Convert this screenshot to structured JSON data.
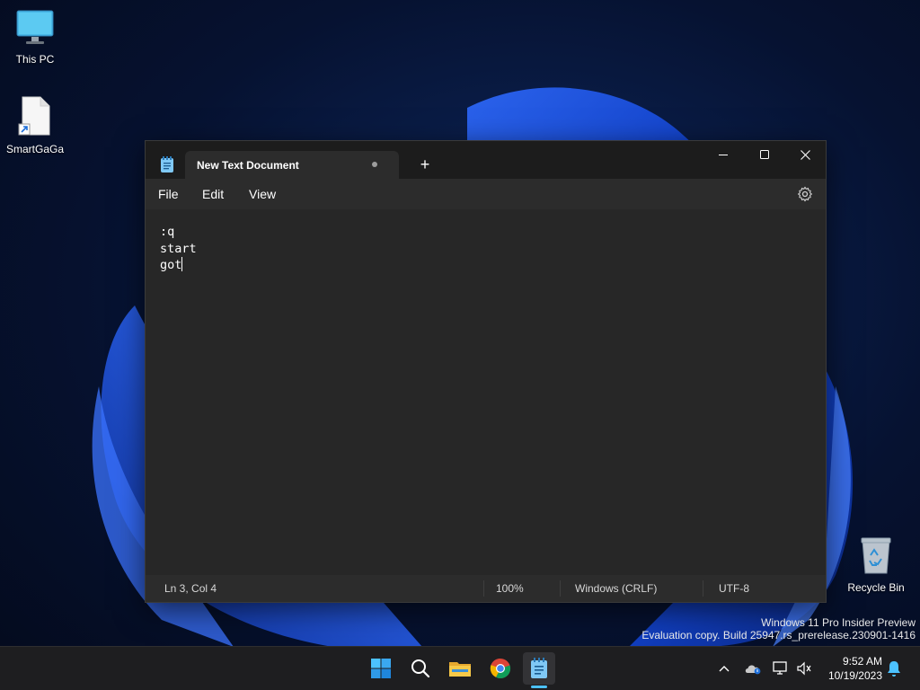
{
  "desktop": {
    "icons": [
      {
        "label": "This PC"
      },
      {
        "label": "SmartGaGa"
      },
      {
        "label": "Recycle Bin"
      }
    ],
    "watermark": {
      "line1": "Windows 11 Pro Insider Preview",
      "line2": "Evaluation copy. Build 25947.rs_prerelease.230901-1416"
    }
  },
  "notepad": {
    "tab_title": "New Text Document",
    "tab_modified_indicator": "●",
    "new_tab_label": "+",
    "menu": [
      "File",
      "Edit",
      "View"
    ],
    "content_lines": [
      ":q",
      "start",
      "got"
    ],
    "status": {
      "position": "Ln 3, Col 4",
      "zoom": "100%",
      "line_ending": "Windows (CRLF)",
      "encoding": "UTF-8"
    },
    "icons": {
      "app": "notepad-icon",
      "minimize": "minimize-icon",
      "maximize": "maximize-icon",
      "close": "close-icon",
      "settings": "gear-icon"
    }
  },
  "taskbar": {
    "apps": [
      "windows-start-icon",
      "search-icon",
      "file-explorer-icon",
      "chrome-icon",
      "notepad-icon"
    ],
    "tray": [
      "chevron-up-icon",
      "onedrive-icon",
      "network-icon",
      "volume-icon",
      "bell-icon"
    ],
    "time": "9:52 AM",
    "date": "10/19/2023"
  },
  "colors": {
    "accent": "#4cc2ff",
    "window_bg": "#202020",
    "editor_bg": "#272727"
  }
}
